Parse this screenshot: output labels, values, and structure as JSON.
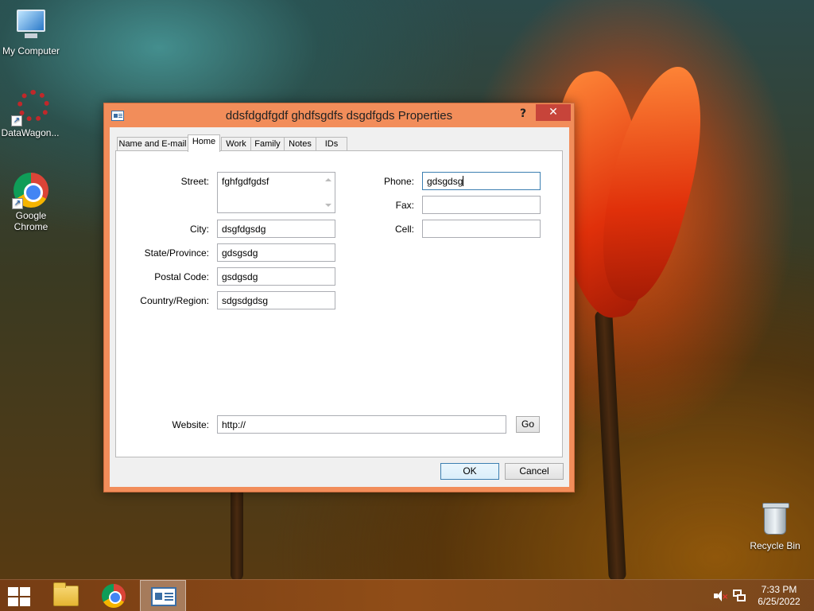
{
  "desktop": {
    "icons": [
      {
        "label": "My Computer",
        "icon": "computer-icon"
      },
      {
        "label": "DataWagon...",
        "icon": "datawagon-icon"
      },
      {
        "label": "Google Chrome",
        "icon": "chrome-icon"
      },
      {
        "label": "Recycle Bin",
        "icon": "recycle-bin-icon"
      }
    ]
  },
  "dialog": {
    "title": "ddsfdgdfgdf ghdfsgdfs dsgdfgds Properties",
    "help_label": "?",
    "close_label": "✕",
    "tabs": [
      {
        "label": "Name and E-mail",
        "active": false
      },
      {
        "label": "Home",
        "active": true
      },
      {
        "label": "Work",
        "active": false
      },
      {
        "label": "Family",
        "active": false
      },
      {
        "label": "Notes",
        "active": false
      },
      {
        "label": "IDs",
        "active": false
      }
    ],
    "home": {
      "street_label": "Street:",
      "street_value": "fghfgdfgdsf",
      "city_label": "City:",
      "city_value": "dsgfdgsdg",
      "state_label": "State/Province:",
      "state_value": "gdsgsdg",
      "postal_label": "Postal Code:",
      "postal_value": "gsdgsdg",
      "country_label": "Country/Region:",
      "country_value": "sdgsdgdsg",
      "phone_label": "Phone:",
      "phone_value": "gdsgdsg",
      "fax_label": "Fax:",
      "fax_value": "",
      "cell_label": "Cell:",
      "cell_value": "",
      "website_label": "Website:",
      "website_value": "http://",
      "go_label": "Go"
    },
    "ok_label": "OK",
    "cancel_label": "Cancel"
  },
  "taskbar": {
    "items": [
      "start-icon",
      "file-explorer-icon",
      "chrome-icon",
      "contact-card-icon"
    ],
    "clock_time": "7:33 PM",
    "clock_date": "6/25/2022"
  }
}
